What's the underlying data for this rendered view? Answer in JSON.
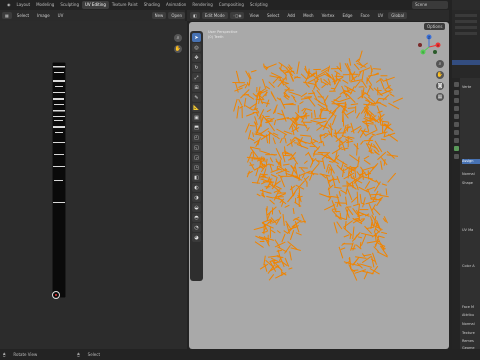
{
  "topbar": {
    "workspaces": [
      "Layout",
      "Modeling",
      "Sculpting",
      "UV Editing",
      "Texture Paint",
      "Shading",
      "Animation",
      "Rendering",
      "Compositing",
      "Scripting"
    ],
    "active_index": 3,
    "scene": "Scene"
  },
  "uv_header": {
    "menus": [
      "Select",
      "Image",
      "UV"
    ],
    "new_label": "New",
    "open_label": "Open"
  },
  "viewport_header": {
    "mode": "Edit Mode",
    "menus": [
      "View",
      "Select",
      "Add",
      "Mesh",
      "Vertex",
      "Edge",
      "Face",
      "UV"
    ],
    "orientation": "Global",
    "options_label": "Options"
  },
  "viewport_info": {
    "line1": "User Perspective",
    "line2": "(0) Teeth"
  },
  "nav_gizmo": {
    "x": "X",
    "y": "Y",
    "z": "Z"
  },
  "properties": {
    "rows": [
      "Verte",
      "Assign",
      "Normal",
      "Shape",
      "UV Ma",
      "Color A",
      "Face M",
      "Attribu",
      "Normal",
      "Texture",
      "Remes",
      "Geome",
      "Custom"
    ]
  },
  "statusbar": {
    "left": "Rotate View",
    "middle": "Select"
  },
  "colors": {
    "mesh": "#f08400",
    "accent": "#4772b3",
    "viewport_bg": "#a9a9a9"
  }
}
